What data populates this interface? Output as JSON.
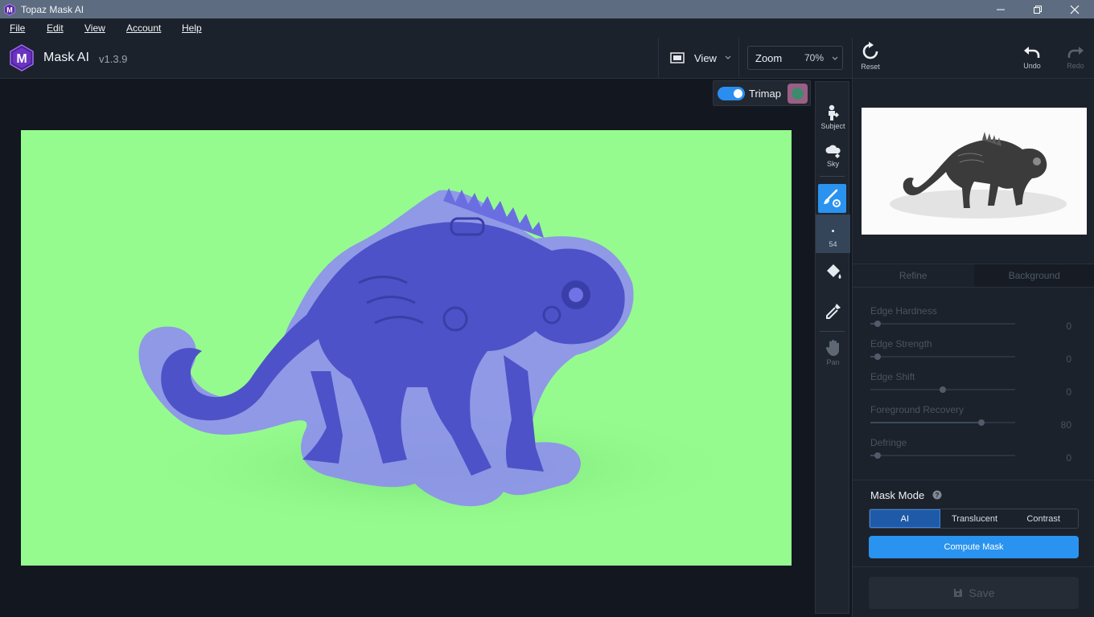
{
  "window": {
    "title": "Topaz Mask AI"
  },
  "menu": {
    "items": [
      "File",
      "Edit",
      "View",
      "Account",
      "Help"
    ]
  },
  "app": {
    "name": "Mask AI",
    "version": "v1.3.9"
  },
  "toolbar": {
    "view_label": "View",
    "zoom_label": "Zoom",
    "zoom_value": "70%",
    "reset_label": "Reset",
    "undo_label": "Undo",
    "redo_label": "Redo"
  },
  "trimap": {
    "label": "Trimap",
    "enabled": true
  },
  "toolstrip": {
    "subject_label": "Subject",
    "sky_label": "Sky",
    "brush_size": "54",
    "pan_label": "Pan"
  },
  "panel": {
    "tabs": [
      "Refine",
      "Background"
    ],
    "sliders": [
      {
        "label": "Edge Hardness",
        "value": "0",
        "fraction": 0.0
      },
      {
        "label": "Edge Strength",
        "value": "0",
        "fraction": 0.0
      },
      {
        "label": "Edge Shift",
        "value": "0",
        "fraction": 0.5
      },
      {
        "label": "Foreground Recovery",
        "value": "80",
        "fraction": 0.8
      },
      {
        "label": "Defringe",
        "value": "0",
        "fraction": 0.0
      }
    ],
    "mask_mode_label": "Mask Mode",
    "mask_modes": [
      "AI",
      "Translucent",
      "Contrast"
    ],
    "mask_mode_selected": "AI",
    "compute_label": "Compute Mask",
    "save_label": "Save"
  },
  "colors": {
    "background_mask": "#95fb8f",
    "foreground_mask": "#5a5fd8",
    "accent": "#2a93ef"
  }
}
